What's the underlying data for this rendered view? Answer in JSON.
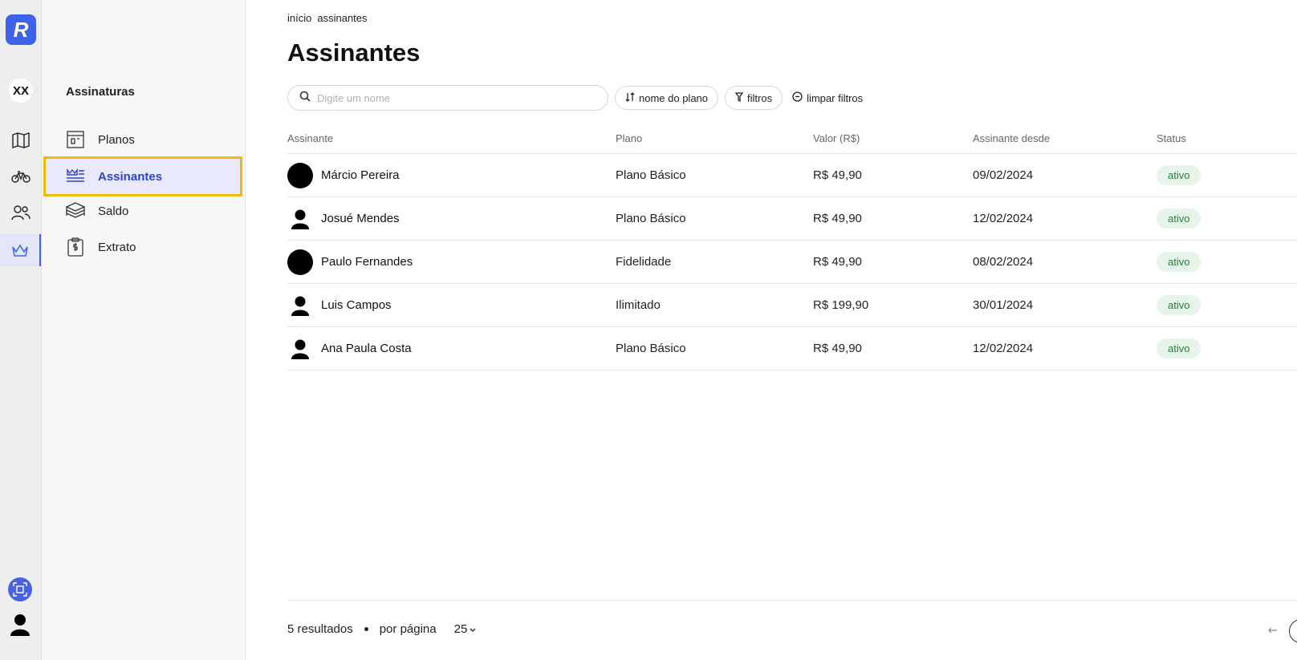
{
  "rail": {
    "logo_letter": "R",
    "avatar_initials": "XX",
    "icons": [
      "map-icon",
      "bike-icon",
      "users-icon",
      "crown-icon"
    ],
    "help_icon": "qr-scan-icon",
    "user_icon": "user-silhouette-icon"
  },
  "sidebar": {
    "title": "Assinaturas",
    "items": [
      {
        "label": "Planos",
        "icon": "store-icon"
      },
      {
        "label": "Assinantes",
        "icon": "subscribers-icon",
        "active": true
      },
      {
        "label": "Saldo",
        "icon": "coins-stack-icon"
      },
      {
        "label": "Extrato",
        "icon": "receipt-clipboard-icon"
      }
    ]
  },
  "breadcrumb": [
    "início",
    "assinantes"
  ],
  "page_title": "Assinantes",
  "search": {
    "placeholder": "Digite um nome",
    "value": ""
  },
  "filters": {
    "sort_label": "nome do plano",
    "filter_label": "filtros",
    "clear_label": "limpar filtros"
  },
  "table": {
    "headers": [
      "Assinante",
      "Plano",
      "Valor (R$)",
      "Assinante desde",
      "Status"
    ],
    "rows": [
      {
        "name": "Márcio Pereira",
        "avatar": "dot",
        "plan": "Plano Básico",
        "value": "R$ 49,90",
        "since": "09/02/2024",
        "status": "ativo"
      },
      {
        "name": "Josué Mendes",
        "avatar": "silhouette",
        "plan": "Plano Básico",
        "value": "R$ 49,90",
        "since": "12/02/2024",
        "status": "ativo"
      },
      {
        "name": "Paulo Fernandes",
        "avatar": "dot",
        "plan": "Fidelidade",
        "value": "R$ 49,90",
        "since": "08/02/2024",
        "status": "ativo"
      },
      {
        "name": "Luis Campos",
        "avatar": "silhouette",
        "plan": "Ilimitado",
        "value": "R$ 199,90",
        "since": "30/01/2024",
        "status": "ativo"
      },
      {
        "name": "Ana Paula Costa",
        "avatar": "silhouette",
        "plan": "Plano Básico",
        "value": "R$ 49,90",
        "since": "12/02/2024",
        "status": "ativo"
      }
    ]
  },
  "footer": {
    "results": "5 resultados",
    "per_page_label": "por página",
    "per_page_value": "25"
  },
  "colors": {
    "accent": "#3f63e8",
    "highlight_border": "#f0b90b",
    "status_bg": "#e7f4ea",
    "status_text": "#2b7a3e"
  }
}
